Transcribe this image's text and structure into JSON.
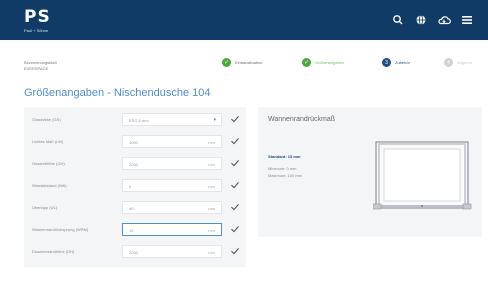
{
  "app": {
    "logo_text": "PS",
    "logo_sub": "Paul + Söhne",
    "icons": [
      "search-icon",
      "globe-icon",
      "cloud-icon",
      "menu-icon"
    ]
  },
  "header": {
    "crumb_label": "Bezeichnungsblatt",
    "crumb_value": "EVERSPACE"
  },
  "steps": [
    {
      "label": "Einbausituation",
      "state": "done",
      "icon": "✓"
    },
    {
      "label": "Größenangaben",
      "state": "done",
      "icon": "✓"
    },
    {
      "label": "Zubehör",
      "state": "active",
      "icon": "3"
    },
    {
      "label": "Angebot",
      "state": "todo",
      "icon": "4"
    }
  ],
  "title": "Größenangaben - Nischendusche 104",
  "form": {
    "rows": [
      {
        "label": "Glasstärke (GS)",
        "value": "ESG 8 mm",
        "unit": "",
        "dropdown": true,
        "focused": false
      },
      {
        "label": "Lichtes Maß (LM)",
        "value": "1000",
        "unit": "mm",
        "dropdown": false,
        "focused": false
      },
      {
        "label": "Gesamthöhe (GH)",
        "value": "2000",
        "unit": "mm",
        "dropdown": false,
        "focused": false
      },
      {
        "label": "Wandabstand (WA)",
        "value": "0",
        "unit": "mm",
        "dropdown": false,
        "focused": false
      },
      {
        "label": "Überlapp (ÜL)",
        "value": "40",
        "unit": "mm",
        "dropdown": false,
        "focused": false
      },
      {
        "label": "Wannenrandrücksprung (WRM)",
        "value": "15",
        "unit": "mm",
        "dropdown": false,
        "focused": true
      },
      {
        "label": "Duschenrandhöhe (DH)",
        "value": "2000",
        "unit": "mm",
        "dropdown": false,
        "focused": false
      }
    ]
  },
  "info": {
    "title": "Wannenrandrückmaß",
    "standard": "Standard: 15 mm",
    "minimum": "Minimum: 0 mm",
    "maximum": "Maximum: 100 mm"
  },
  "colors": {
    "topbar": "#0f3b66",
    "accent_blue": "#4f8fca",
    "done_green": "#4aa83d",
    "active_blue": "#1e4f86"
  }
}
